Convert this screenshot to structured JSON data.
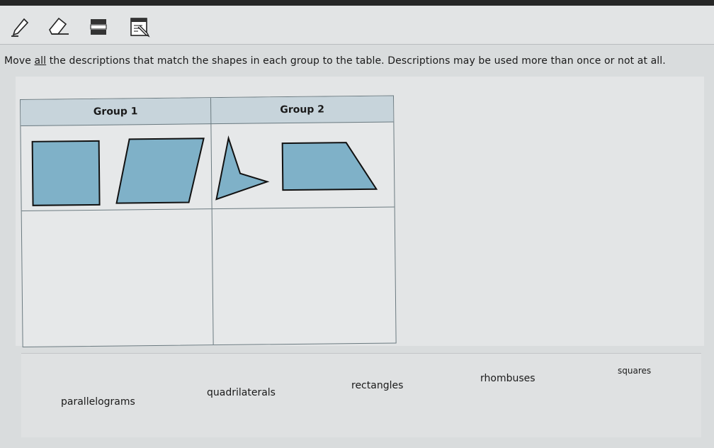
{
  "toolbar": {
    "tools": [
      {
        "name": "pencil-icon"
      },
      {
        "name": "eraser-icon"
      },
      {
        "name": "line-reader-icon"
      },
      {
        "name": "notepad-icon"
      }
    ]
  },
  "prompt": {
    "before": "Move ",
    "emphasis": "all",
    "after": " the descriptions that match the shapes in each group to the table. Descriptions may be used more than once or not at all."
  },
  "table": {
    "headers": [
      "Group 1",
      "Group 2"
    ],
    "group1_shapes": [
      "square",
      "parallelogram"
    ],
    "group2_shapes": [
      "concave-quadrilateral",
      "trapezoid"
    ]
  },
  "answer_bank": {
    "items": [
      "parallelograms",
      "quadrilaterals",
      "rectangles",
      "rhombuses",
      "squares"
    ]
  },
  "colors": {
    "shape_fill": "#7fb1c8",
    "header_fill": "#c7d4db",
    "border": "#6b7a80"
  }
}
